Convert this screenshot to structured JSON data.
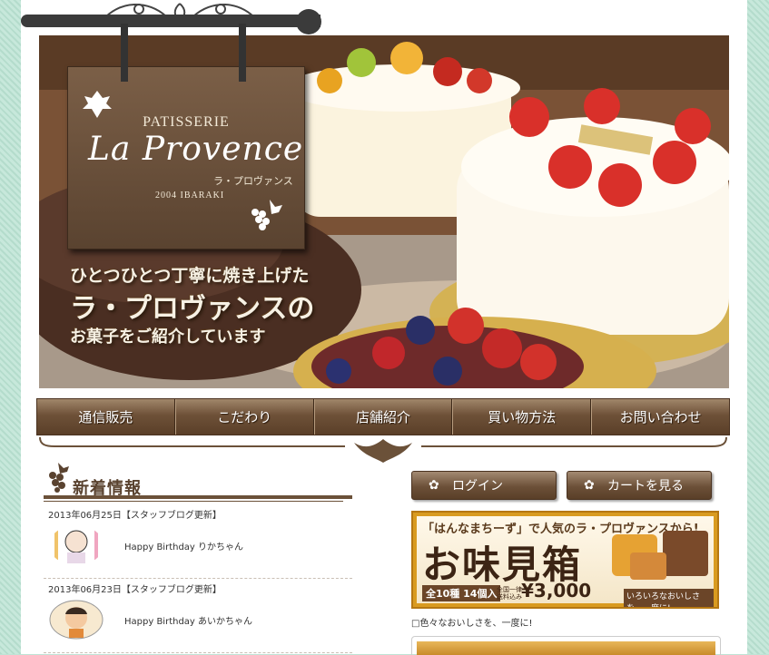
{
  "brand": {
    "sub": "PATISSERIE",
    "main": "La Provence",
    "kana": "ラ・プロヴァンス",
    "year": "2004 IBARAKI"
  },
  "hero": {
    "tagline1": "ひとつひとつ丁寧に焼き上げた",
    "tagline2": "ラ・プロヴァンスの",
    "tagline3": "お菓子をご紹介しています"
  },
  "nav": {
    "items": [
      "通信販売",
      "こだわり",
      "店舗紹介",
      "買い物方法",
      "お問い合わせ"
    ]
  },
  "news": {
    "title": "新着情報",
    "items": [
      {
        "date": "2013年06月25日【スタッフブログ更新】",
        "text": "Happy Birthday りかちゃん"
      },
      {
        "date": "2013年06月23日【スタッフブログ更新】",
        "text": "Happy Birthday あいかちゃん"
      }
    ]
  },
  "buttons": {
    "login": "ログイン",
    "cart": "カートを見る"
  },
  "banner": {
    "top": "「はんなまちーず」で人気のラ・プロヴァンスから!",
    "main": "お味見箱",
    "sub": "全10種 14個入",
    "shipping": "全国一律 送料込み",
    "price": "¥3,000",
    "note": "いろいろなおいしさを、一度に!",
    "caption": "色々なおいしさを、一度に!"
  }
}
